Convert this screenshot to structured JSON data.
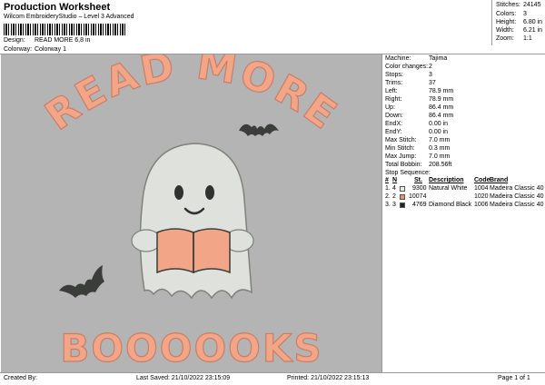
{
  "header": {
    "title": "Production Worksheet",
    "subtitle": "Wilcom EmbroideryStudio – Level 3 Advanced",
    "design_label": "Design:",
    "design_value": "READ MORE 6,8 in",
    "colorway_label": "Colorway:",
    "colorway_value": "Colorway 1"
  },
  "stats": [
    {
      "label": "Stitches:",
      "value": "24145"
    },
    {
      "label": "Colors:",
      "value": "3"
    },
    {
      "label": "Height:",
      "value": "6.80 in"
    },
    {
      "label": "Width:",
      "value": "6.21 in"
    },
    {
      "label": "Zoom:",
      "value": "1:1"
    }
  ],
  "info": [
    {
      "label": "Machine:",
      "value": "Tajima"
    },
    {
      "label": "Color changes:",
      "value": "2"
    },
    {
      "label": "Stops:",
      "value": "3"
    },
    {
      "label": "Trims:",
      "value": "37"
    },
    {
      "label": "Left:",
      "value": "78.9 mm"
    },
    {
      "label": "Right:",
      "value": "78.9 mm"
    },
    {
      "label": "Up:",
      "value": "86.4 mm"
    },
    {
      "label": "Down:",
      "value": "86.4 mm"
    },
    {
      "label": "EndX:",
      "value": "0.00 in"
    },
    {
      "label": "EndY:",
      "value": "0.00 in"
    },
    {
      "label": "Max Stitch:",
      "value": "7.0 mm"
    },
    {
      "label": "Min Stitch:",
      "value": "0.3 mm"
    },
    {
      "label": "Max Jump:",
      "value": "7.0 mm"
    },
    {
      "label": "Total Bobbin:",
      "value": "208.56ft"
    }
  ],
  "stop_sequence": {
    "title": "Stop Sequence:",
    "columns": {
      "hash": "#",
      "n": "N",
      "st": "St.",
      "description": "Description",
      "code": "Code",
      "brand": "Brand"
    },
    "rows": [
      {
        "index": "1.",
        "n": "4",
        "color": "#ecece4",
        "st": "9300",
        "description": "Natural White",
        "code": "1004",
        "brand": "Madeira Classic 40"
      },
      {
        "index": "2.",
        "n": "2",
        "color": "#f0906a",
        "st": "10074",
        "description": "",
        "code": "1020",
        "brand": "Madeira Classic 40"
      },
      {
        "index": "3.",
        "n": "3",
        "color": "#222222",
        "st": "4769",
        "description": "Diamond Black",
        "code": "1006",
        "brand": "Madeira Classic 40"
      }
    ]
  },
  "design": {
    "text_top": "READ MORE",
    "text_bottom": "BOOOOOKS",
    "letter_color": "#f3a587",
    "ghost_color": "#dfe2dc",
    "book_color": "#f3a587",
    "bat_color": "#3a3d3a",
    "background": "#b4b4b4"
  },
  "footer": {
    "created_by": "Created By:",
    "last_saved": "Last Saved: 21/10/2022 23:15:09",
    "printed": "Printed: 21/10/2022 23:15:13",
    "page": "Page 1 of 1"
  }
}
